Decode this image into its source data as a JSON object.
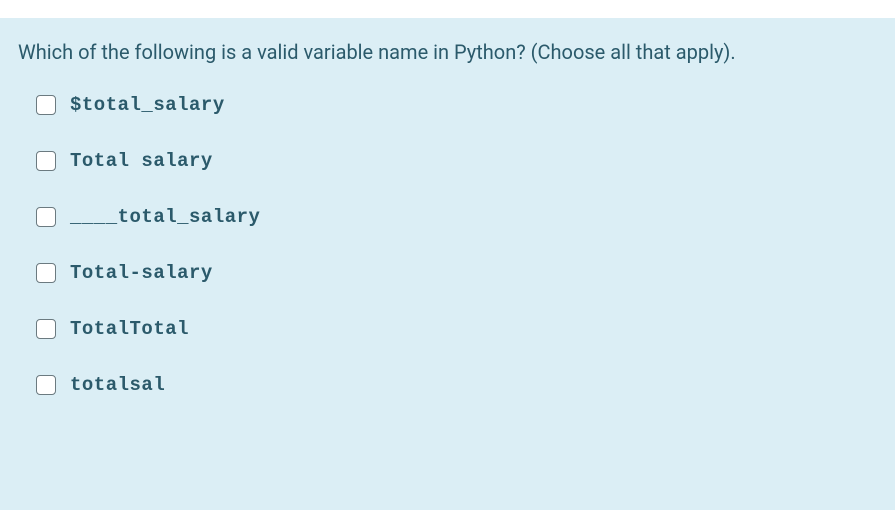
{
  "question": {
    "text": "Which of the following is a valid variable name in Python? (Choose all that apply)."
  },
  "options": [
    {
      "label": "$total_salary",
      "checked": false
    },
    {
      "label": "Total salary",
      "checked": false
    },
    {
      "label": "____total_salary",
      "checked": false
    },
    {
      "label": "Total-salary",
      "checked": false
    },
    {
      "label": "TotalTotal",
      "checked": false
    },
    {
      "label": "totalsal",
      "checked": false
    }
  ]
}
